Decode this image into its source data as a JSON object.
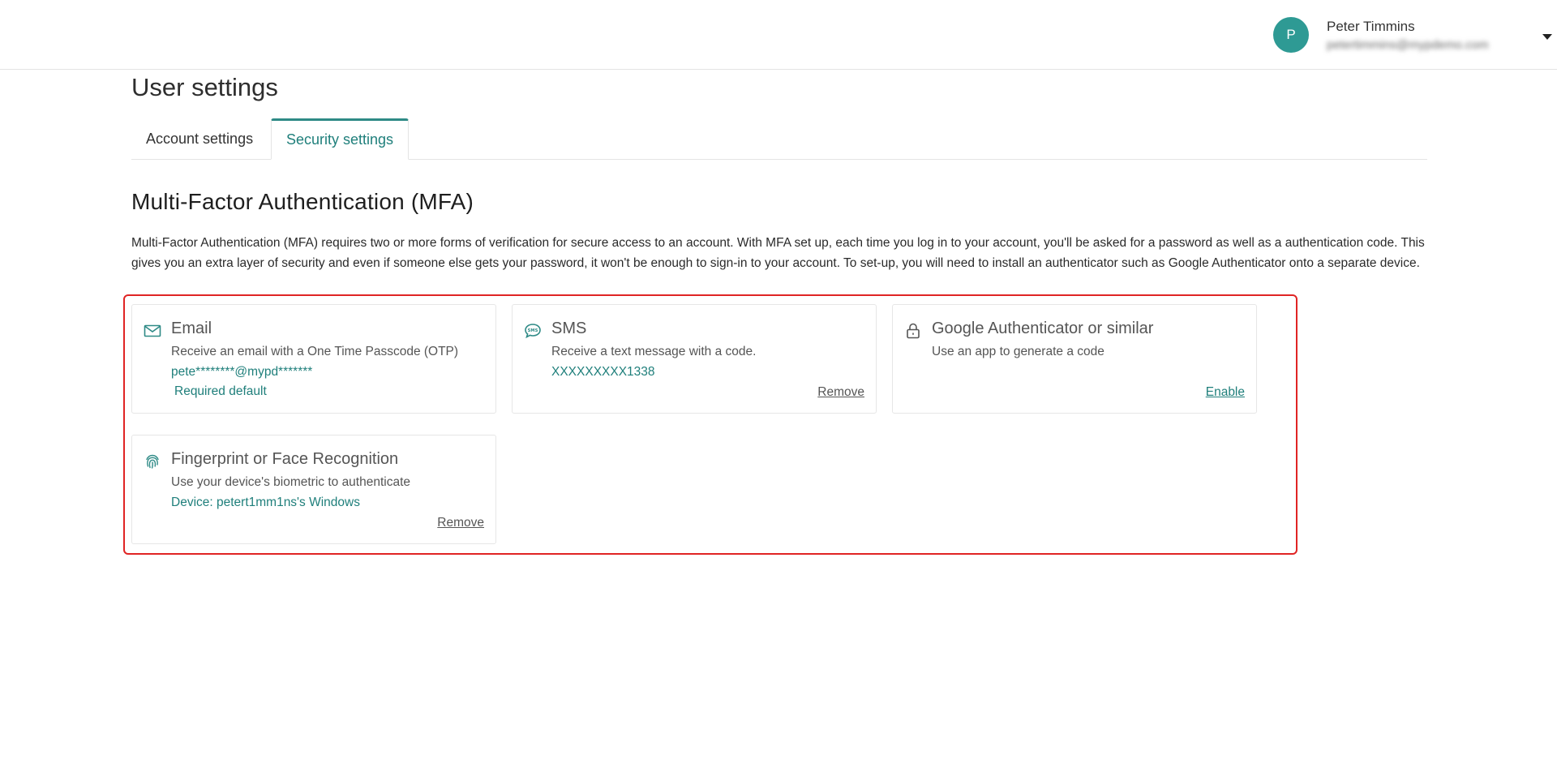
{
  "header": {
    "avatar_initial": "P",
    "user_name": "Peter Timmins",
    "user_email": "petertimmins@mypdemo.com",
    "caret_icon": "caret-down-icon"
  },
  "page": {
    "title": "User settings",
    "tabs": [
      {
        "label": "Account settings",
        "active": false
      },
      {
        "label": "Security settings",
        "active": true
      }
    ]
  },
  "mfa": {
    "heading": "Multi-Factor Authentication (MFA)",
    "description": "Multi-Factor Authentication (MFA) requires two or more forms of verification for secure access to an account. With MFA set up, each time you log in to your account, you'll be asked for a password as well as a authentication code. This gives you an extra layer of security and even if someone else gets your password, it won't be enough to sign-in to your account. To set-up, you will need to install an authenticator such as Google Authenticator onto a separate device.",
    "accent_color": "#2e8a86",
    "highlight_color": "#e02424",
    "methods": {
      "email": {
        "icon": "envelope-icon",
        "title": "Email",
        "description": "Receive an email with a One Time Passcode (OTP)",
        "detail": "pete********@mypd*******",
        "badge": "Required default"
      },
      "sms": {
        "icon": "sms-icon",
        "title": "SMS",
        "description": "Receive a text message with a code.",
        "detail": "XXXXXXXXX1338",
        "action": "Remove"
      },
      "authenticator": {
        "icon": "lock-icon",
        "title": "Google Authenticator or similar",
        "description": "Use an app to generate a code",
        "action": "Enable"
      },
      "biometric": {
        "icon": "fingerprint-icon",
        "title": "Fingerprint or Face Recognition",
        "description": "Use your device's biometric to authenticate",
        "detail": "Device: petert1mm1ns's Windows",
        "action": "Remove"
      }
    }
  }
}
